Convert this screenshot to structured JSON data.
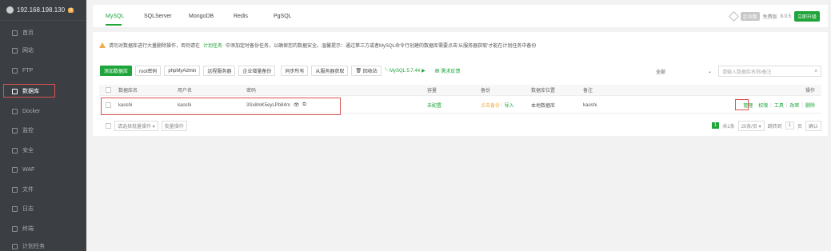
{
  "sidebar": {
    "ip": "192.168.198.130",
    "badge": "0",
    "items": [
      {
        "label": "首页",
        "icon": "home-icon"
      },
      {
        "label": "网站",
        "icon": "globe-icon"
      },
      {
        "label": "FTP",
        "icon": "ftp-icon"
      },
      {
        "label": "数据库",
        "icon": "database-icon"
      },
      {
        "label": "Docker",
        "icon": "docker-icon"
      },
      {
        "label": "监控",
        "icon": "monitor-icon"
      },
      {
        "label": "安全",
        "icon": "shield-icon"
      },
      {
        "label": "WAF",
        "icon": "waf-icon"
      },
      {
        "label": "文件",
        "icon": "folder-icon"
      },
      {
        "label": "日志",
        "icon": "log-icon"
      },
      {
        "label": "终端",
        "icon": "terminal-icon"
      },
      {
        "label": "计划任务",
        "icon": "clock-icon"
      }
    ]
  },
  "tabs": [
    "MySQL",
    "SQLServer",
    "MongoDB",
    "Redis",
    "PgSQL"
  ],
  "topright": {
    "enterprise": "企业版",
    "version_label": "免费版",
    "version": "8.0.5",
    "upgrade": "立即升级"
  },
  "warning": {
    "prefix": "请勿对数据库进行大量删除操作，否则请在",
    "link": "计划任务",
    "suffix": "中添加定时备份任务，以确保您的数据安全。温馨提示：通过第三方或者MySQL命令行创建的数据库需要点击'从服务器获取'才能在计划任务中备份"
  },
  "toolbar": {
    "add_db": "添加数据库",
    "root_pwd": "root密码",
    "phpmyadmin": "phpMyAdmin",
    "remote": "远程服务器",
    "backup": "企业增量备份",
    "sync_all": "同步所有",
    "from_server": "从服务器获取",
    "recycle": "回收站",
    "mysql_version": "MySQL 5.7.44",
    "install_hint": "需求反馈"
  },
  "filter": {
    "select": "全部",
    "search_placeholder": "请输入数据库名称/备注"
  },
  "table": {
    "headers": [
      "数据库名",
      "用户名",
      "密码",
      "容量",
      "备份",
      "数据库位置",
      "备注",
      "操作"
    ],
    "rows": [
      {
        "db": "kaoshi",
        "user": "kaoshi",
        "password": "3Sx8mK5eyLPb84m",
        "capacity": "未配置",
        "backup_action": "点击备份",
        "import": "导入",
        "location": "本地数据库",
        "note": "kaoshi",
        "ops": [
          "管理",
          "权限",
          "工具",
          "改密",
          "删除"
        ]
      }
    ]
  },
  "footer": {
    "batch_select": "请选择批量操作",
    "batch_exec": "批量操作",
    "page": "1",
    "total": "共1条",
    "per_page": "20条/页",
    "goto": "跳转到",
    "goto_page": "1",
    "page_unit": "页",
    "confirm": "确认"
  }
}
